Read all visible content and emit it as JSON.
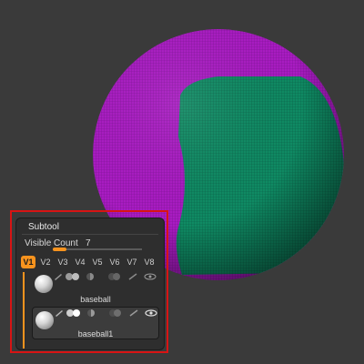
{
  "subtool": {
    "title": "Subtool",
    "visible_count_label": "Visible Count",
    "visible_count_value": "7",
    "slider_level": 0.15,
    "version_buttons": [
      "V1",
      "V2",
      "V3",
      "V4",
      "V5",
      "V6",
      "V7",
      "V8"
    ],
    "active_version": "V1",
    "items": [
      {
        "name": "baseball",
        "selected": false
      },
      {
        "name": "baseball1",
        "selected": true
      }
    ]
  },
  "colors": {
    "background": "#3a3a3a",
    "mesh_magenta": "#b01ec8",
    "mesh_green": "#0f8a63",
    "highlight_frame": "#d81414",
    "accent": "#f7931e"
  },
  "icons": [
    "sphere-thumbnail-icon",
    "brush-icon",
    "visibility-toggle-icon",
    "polypaint-icon",
    "eye-icon"
  ]
}
